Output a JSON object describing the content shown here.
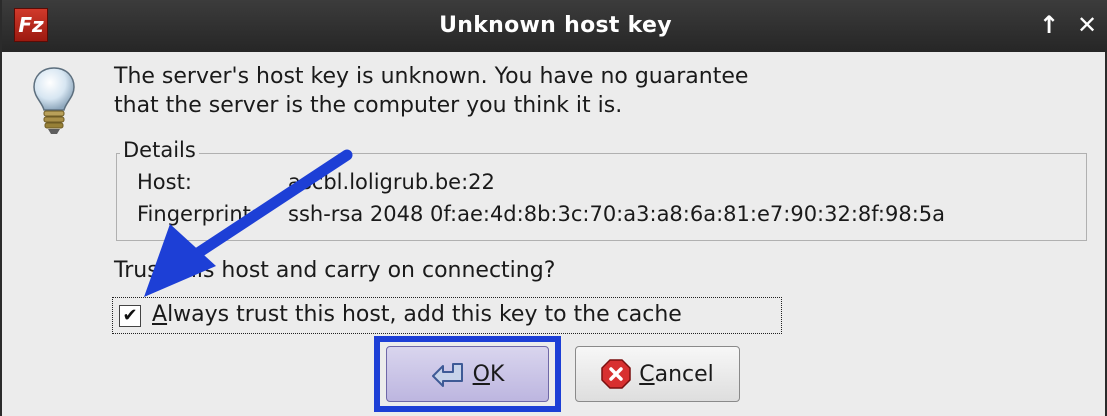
{
  "window": {
    "title": "Unknown host key",
    "app_icon_text": "Fz",
    "maximize_glyph": "↑",
    "close_glyph": "✕"
  },
  "message": {
    "line1": "The server's host key is unknown. You have no guarantee",
    "line2": "that the server is the computer you think it is."
  },
  "details": {
    "legend": "Details",
    "host_label": "Host:",
    "host_value": "ascbl.loligrub.be:22",
    "fingerprint_label": "Fingerprint:",
    "fingerprint_value": "ssh-rsa 2048 0f:ae:4d:8b:3c:70:a3:a8:6a:81:e7:90:32:8f:98:5a"
  },
  "question": "Trust this host and carry on connecting?",
  "checkbox": {
    "checked": true,
    "mark": "✔",
    "label_accel": "A",
    "label_rest": "lways trust this host, add this key to the cache"
  },
  "buttons": {
    "ok_accel": "O",
    "ok_rest": "K",
    "cancel_accel": "C",
    "cancel_rest": "ancel"
  },
  "colors": {
    "annotation_blue": "#1d3fd6",
    "ok_button": "#c9c3e6",
    "titlebar": "#2e2e2e"
  },
  "icons": [
    "filezilla-icon",
    "lightbulb-icon",
    "return-arrow-icon",
    "cancel-x-icon"
  ]
}
